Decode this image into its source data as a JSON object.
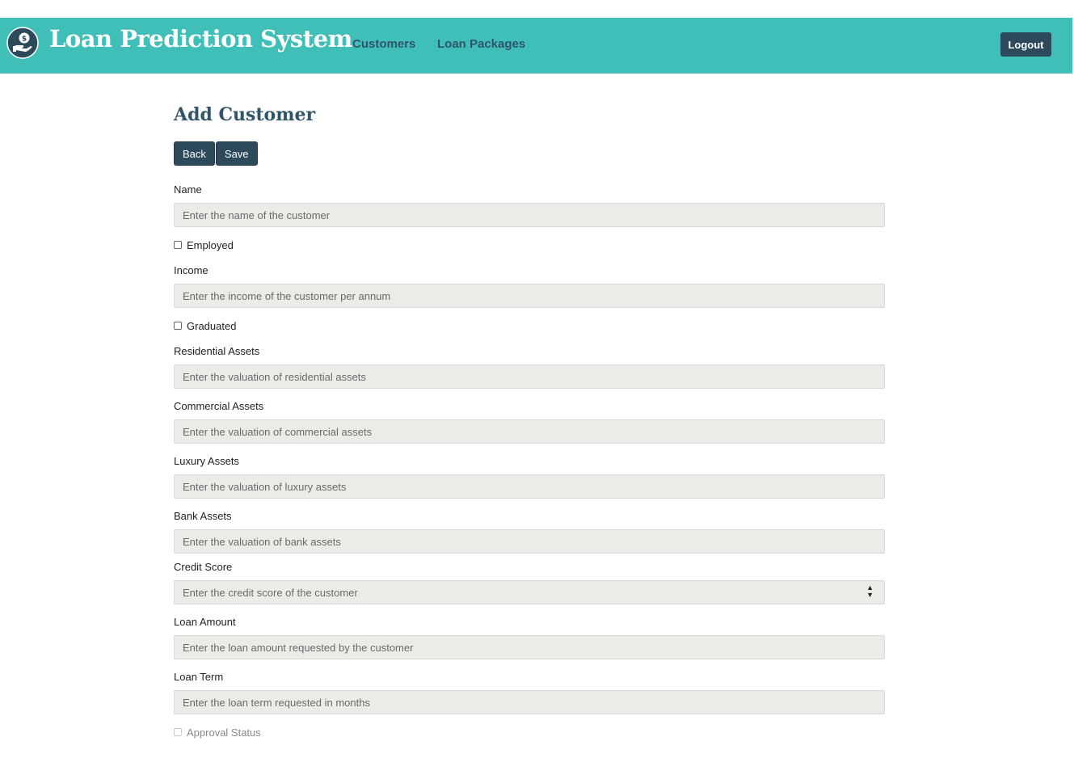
{
  "header": {
    "title": "Loan Prediction System",
    "logo_icon": "hand-dollar-icon",
    "nav": [
      {
        "label": "Customers"
      },
      {
        "label": "Loan Packages"
      }
    ],
    "logout_label": "Logout",
    "colors": {
      "bar": "#40bfb8",
      "nav_text": "#2e5568",
      "button": "#2c4a5c"
    }
  },
  "page": {
    "title": "Add Customer",
    "back_label": "Back",
    "save_label": "Save"
  },
  "form": {
    "name": {
      "label": "Name",
      "placeholder": "Enter the name of the customer"
    },
    "employed": {
      "label": "Employed"
    },
    "income": {
      "label": "Income",
      "placeholder": "Enter the income of the customer per annum"
    },
    "graduated": {
      "label": "Graduated"
    },
    "residential": {
      "label": "Residential Assets",
      "placeholder": "Enter the valuation of residential assets"
    },
    "commercial": {
      "label": "Commercial Assets",
      "placeholder": "Enter the valuation of commercial assets"
    },
    "luxury": {
      "label": "Luxury Assets",
      "placeholder": "Enter the valuation of luxury assets"
    },
    "bank": {
      "label": "Bank Assets",
      "placeholder": "Enter the valuation of bank assets"
    },
    "credit_score": {
      "label": "Credit Score",
      "placeholder": "Enter the credit score of the customer"
    },
    "loan_amount": {
      "label": "Loan Amount",
      "placeholder": "Enter the loan amount requested by the customer"
    },
    "loan_term": {
      "label": "Loan Term",
      "placeholder": "Enter the loan term requested in months"
    },
    "approval": {
      "label": "Approval Status"
    }
  }
}
